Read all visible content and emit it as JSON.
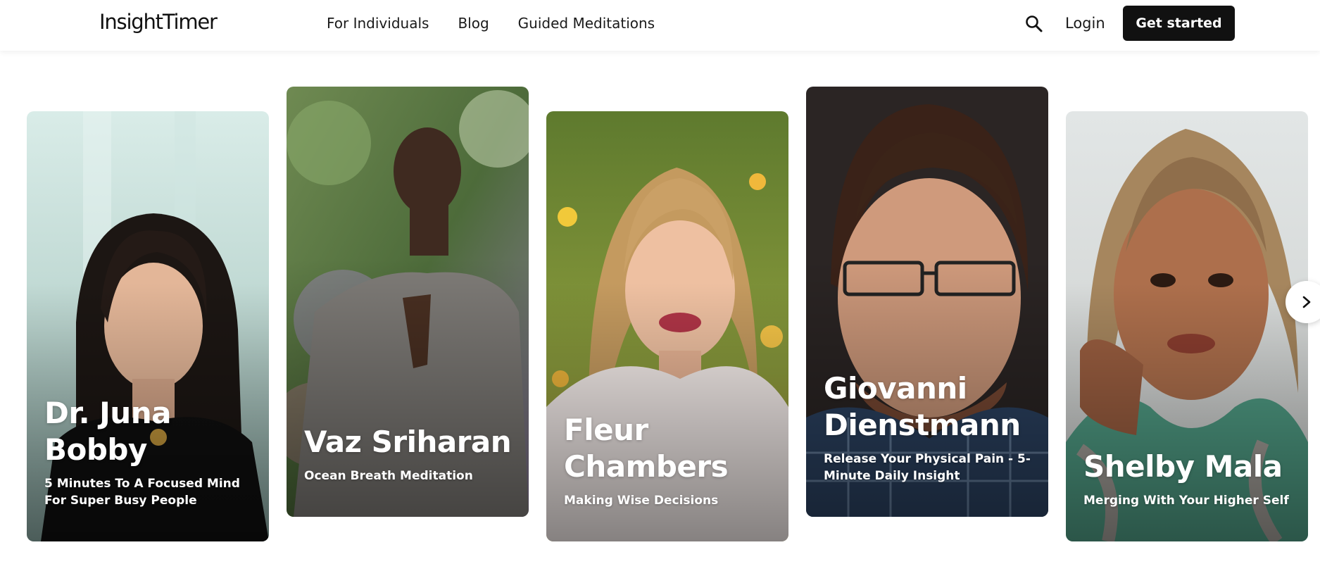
{
  "header": {
    "logo": "InsightTimer",
    "nav": [
      "For Individuals",
      "Blog",
      "Guided Meditations"
    ],
    "search_icon": "search-icon",
    "login": "Login",
    "cta": "Get started"
  },
  "cards": [
    {
      "name": "Dr. Juna Bobby",
      "subtitle": "5 Minutes To A Focused Mind For Super Busy People"
    },
    {
      "name": "Vaz Sriharan",
      "subtitle": "Ocean Breath Meditation"
    },
    {
      "name": "Fleur Chambers",
      "subtitle": "Making Wise Decisions"
    },
    {
      "name": "Giovanni Dienstmann",
      "subtitle": "Release Your Physical Pain - 5-Minute Daily Insight"
    },
    {
      "name": "Shelby Mala",
      "subtitle": "Merging With Your Higher Self"
    }
  ],
  "carousel": {
    "next_icon": "chevron-right-icon"
  }
}
